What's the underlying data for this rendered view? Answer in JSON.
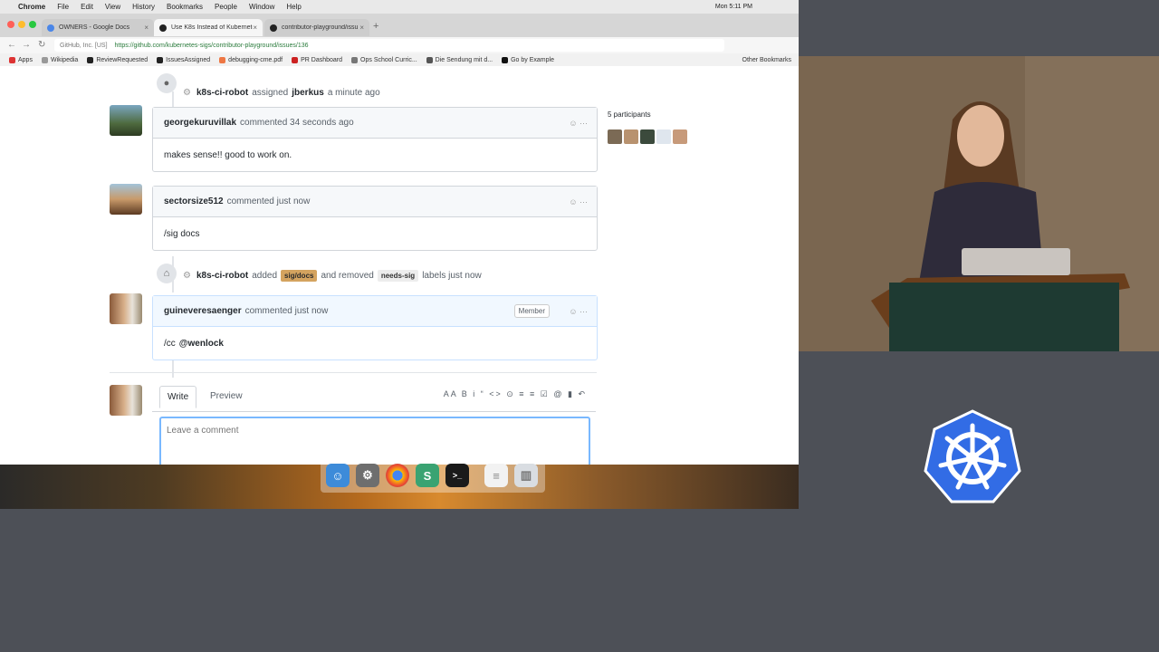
{
  "menubar": {
    "app": "Chrome",
    "items": [
      "File",
      "Edit",
      "View",
      "History",
      "Bookmarks",
      "People",
      "Window",
      "Help"
    ],
    "clock": "Mon 5:11 PM"
  },
  "tabs": [
    {
      "title": "OWNERS - Google Docs",
      "close": "×"
    },
    {
      "title": "Use K8s Instead of Kubernetes",
      "close": "×"
    },
    {
      "title": "contributor-playground/issue",
      "close": "×"
    }
  ],
  "address": {
    "host": "GitHub, Inc. [US]",
    "url": "https://github.com/kubernetes-sigs/contributor-playground/issues/136"
  },
  "bookmarks": [
    "Apps",
    "Wikipedia",
    "ReviewRequested",
    "IssuesAssigned",
    "debugging-cme.pdf",
    "PR Dashboard",
    "Ops School Curric...",
    "Die Sendung mit d...",
    "Go by Example",
    "Other Bookmarks"
  ],
  "timeline": {
    "assign_event": {
      "actor": "k8s-ci-robot",
      "verb": "assigned",
      "target": "jberkus",
      "time": "a minute ago"
    },
    "comments": [
      {
        "author": "georgekuruvillak",
        "action": "commented 34 seconds ago",
        "body": "makes sense!! good to work on."
      },
      {
        "author": "sectorsize512",
        "action": "commented just now",
        "body": "/sig docs"
      },
      {
        "author": "guineveresaenger",
        "action": "commented just now",
        "badge": "Member",
        "body_prefix": "/cc",
        "mention": "@wenlock"
      }
    ],
    "label_event": {
      "actor": "k8s-ci-robot",
      "verb_added": "added",
      "label_added": "sig/docs",
      "verb_removed": "and removed",
      "label_removed": "needs-sig",
      "suffix": "labels just now"
    }
  },
  "sidebar": {
    "participants_title": "5 participants"
  },
  "editor": {
    "tab_write": "Write",
    "tab_preview": "Preview",
    "toolbar": "AA B i  “ <> ⊙  ≡ ≡ ☑  @ ▮ ↶",
    "placeholder": "Leave a comment"
  },
  "colors": {
    "label_sig_docs": "#d4a35f",
    "label_needs_sig": "#ededed",
    "k8s_blue": "#326ce5"
  }
}
